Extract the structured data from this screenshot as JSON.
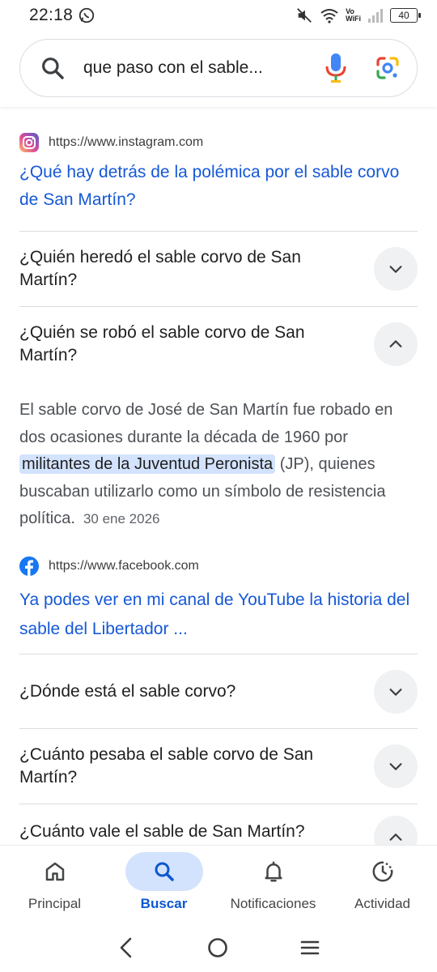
{
  "status_bar": {
    "time": "22:18",
    "battery": "40",
    "vo_label": "Vo",
    "wifi_label": "WiFi"
  },
  "search": {
    "query": "que paso con el sable..."
  },
  "results": {
    "instagram": {
      "url": "https://www.instagram.com",
      "title": "¿Qué hay detrás de la polémica por el sable corvo de San Martín?"
    },
    "facebook": {
      "url": "https://www.facebook.com",
      "title": "Ya podes ver en mi canal de YouTube la historia del sable del Libertador ..."
    }
  },
  "faq": [
    {
      "question": "¿Quién heredó el sable corvo de San Martín?",
      "expanded": false
    },
    {
      "question": "¿Quién se robó el sable corvo de San Martín?",
      "expanded": true
    },
    {
      "question": "¿Dónde está el sable corvo?",
      "expanded": false
    },
    {
      "question": "¿Cuánto pesaba el sable corvo de San Martín?",
      "expanded": false
    },
    {
      "question": "¿Cuánto vale el sable de San Martín?",
      "expanded": true
    }
  ],
  "answer": {
    "before": "El sable corvo de José de San Martín fue robado en dos ocasiones durante la década de 1960 por ",
    "highlight": "militantes de la Juventud Peronista",
    "after": " (JP), quienes buscaban utilizarlo como un símbolo de resistencia política.",
    "date": "30 ene 2026"
  },
  "bottom_nav": [
    {
      "label": "Principal",
      "icon": "home-icon",
      "active": false
    },
    {
      "label": "Buscar",
      "icon": "search-icon",
      "active": true
    },
    {
      "label": "Notificaciones",
      "icon": "bell-icon",
      "active": false
    },
    {
      "label": "Actividad",
      "icon": "activity-icon",
      "active": false
    }
  ],
  "colors": {
    "link": "#1558d6",
    "highlight": "#d3e3fd",
    "active_nav": "#0b57d0"
  }
}
